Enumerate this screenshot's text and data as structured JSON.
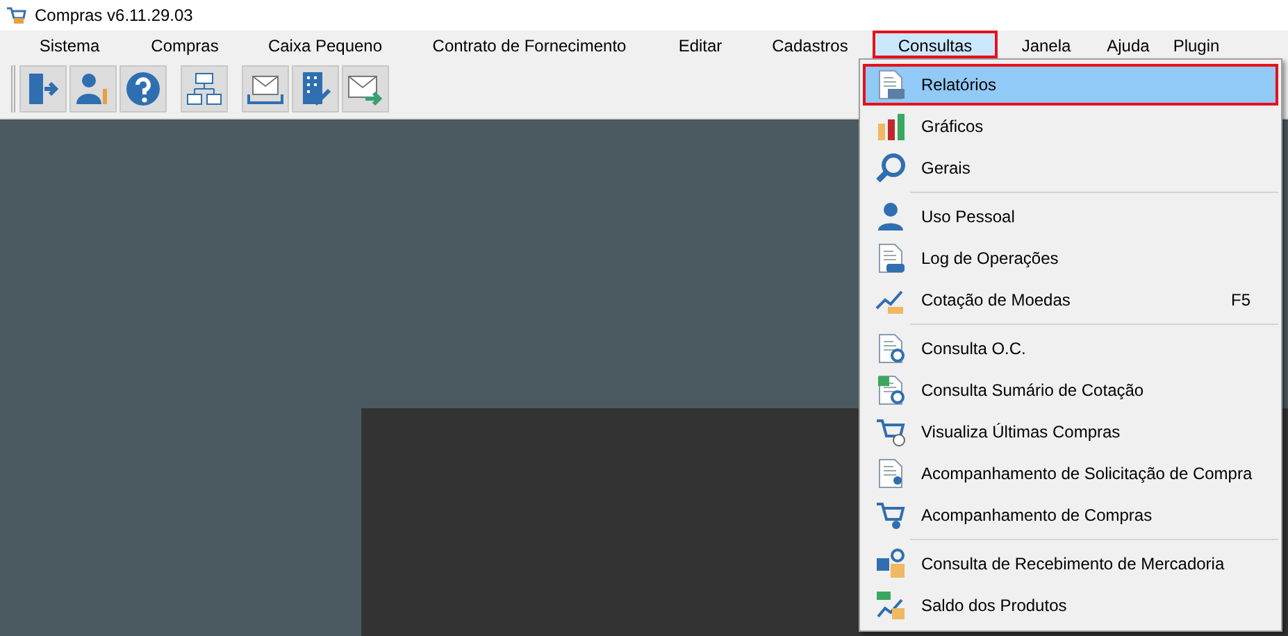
{
  "window": {
    "title": "Compras v6.11.29.03"
  },
  "menu_bar": [
    {
      "label": "Sistema",
      "selected": false
    },
    {
      "label": "Compras",
      "selected": false
    },
    {
      "label": "Caixa Pequeno",
      "selected": false
    },
    {
      "label": "Contrato de Fornecimento",
      "selected": false
    },
    {
      "label": "Editar",
      "selected": false
    },
    {
      "label": "Cadastros",
      "selected": false
    },
    {
      "label": "Consultas",
      "selected": true
    },
    {
      "label": "Janela",
      "selected": false
    },
    {
      "label": "Ajuda",
      "selected": false
    },
    {
      "label": "Plugin",
      "selected": false
    }
  ],
  "dropdown": {
    "groups": [
      [
        {
          "label": "Relatórios",
          "selected": true
        },
        {
          "label": "Gráficos",
          "selected": false
        },
        {
          "label": "Gerais",
          "selected": false
        }
      ],
      [
        {
          "label": "Uso Pessoal",
          "selected": false
        },
        {
          "label": "Log de Operações",
          "selected": false
        },
        {
          "label": "Cotação de Moedas",
          "shortcut": "F5",
          "selected": false
        }
      ],
      [
        {
          "label": "Consulta O.C.",
          "selected": false
        },
        {
          "label": "Consulta Sumário de Cotação",
          "selected": false
        },
        {
          "label": "Visualiza Últimas Compras",
          "selected": false
        },
        {
          "label": "Acompanhamento de Solicitação de Compra",
          "selected": false
        },
        {
          "label": "Acompanhamento de Compras",
          "selected": false
        }
      ],
      [
        {
          "label": "Consulta de Recebimento de Mercadoria",
          "selected": false
        },
        {
          "label": "Saldo dos Produtos",
          "selected": false
        }
      ]
    ]
  }
}
